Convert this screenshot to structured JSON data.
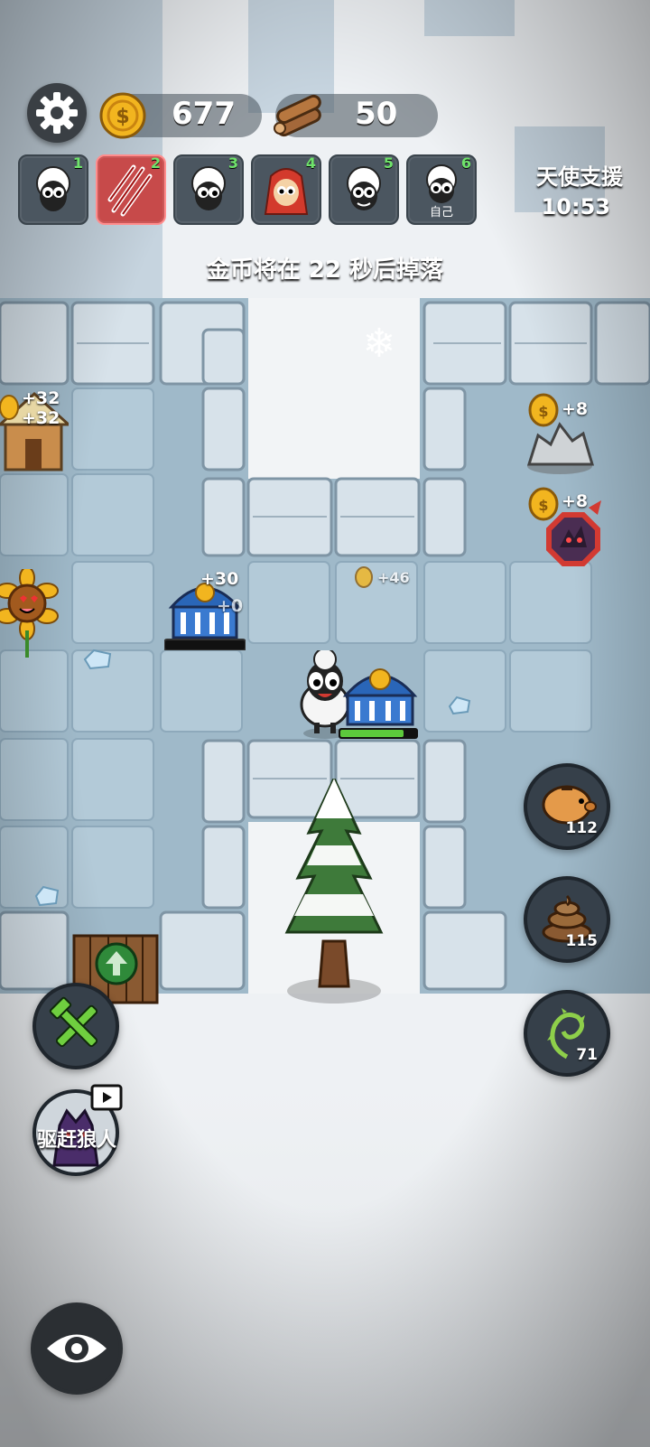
{
  "hud": {
    "coins": "677",
    "wood": "50",
    "settings_icon": "gear-icon",
    "coin_icon": "coin-icon",
    "wood_icon": "wood-logs-icon"
  },
  "players": [
    {
      "slot": "1",
      "icon": "sheep-icon"
    },
    {
      "slot": "2",
      "icon": "werewolf-claw-icon",
      "active": true
    },
    {
      "slot": "3",
      "icon": "sheep-icon"
    },
    {
      "slot": "4",
      "icon": "red-hood-sheep-icon"
    },
    {
      "slot": "5",
      "icon": "sheep-icon"
    },
    {
      "slot": "6",
      "icon": "sheep-icon",
      "label": "自己"
    }
  ],
  "angel_support": {
    "title": "天使支援",
    "timer": "10:53"
  },
  "coin_drop_message": "金币将在 22 秒后掉落",
  "floating_income": {
    "left_top_a": "+32",
    "left_top_b": "+32",
    "right_top_a": "+8",
    "right_top_b": "+8",
    "mid_left": "+30",
    "mid_left_b": "+0",
    "center": "+46"
  },
  "resources": {
    "piggy_bank": "112",
    "poop": "115",
    "thorn_vine": "71"
  },
  "actions": {
    "build_icon": "wrench-hammer-icon",
    "drive_werewolf": "驱赶狼人",
    "video_icon": "video-ad-icon",
    "view_icon": "eye-icon"
  },
  "colors": {
    "ice": "#a9c2d1",
    "wall": "#d7e2ea",
    "hp_green": "#5cc93c",
    "coin_gold": "#f2b51f",
    "danger_red": "#d23a32"
  }
}
